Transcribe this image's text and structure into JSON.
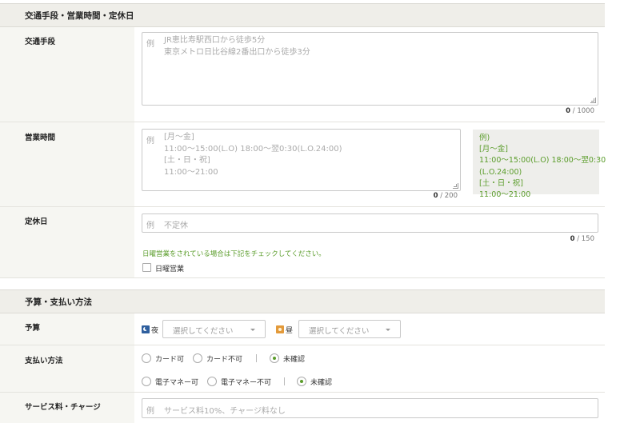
{
  "section_access": {
    "title": "交通手段・営業時間・定休日"
  },
  "access": {
    "label": "交通手段",
    "example_prefix": "例",
    "placeholder_lines": "JR恵比寿駅西口から徒歩5分\n東京メトロ日比谷線2番出口から徒歩3分",
    "count_current": "0",
    "count_max": " / 1000"
  },
  "hours": {
    "label": "営業時間",
    "example_prefix": "例",
    "placeholder_lines": "[月～金]\n11:00～15:00(L.O) 18:00～翌0:30(L.O.24:00)\n[土・日・祝]\n11:00～21:00",
    "count_current": "0",
    "count_max": " / 200",
    "example_box": "例)\n[月～金]\n11:00～15:00(L.O) 18:00～翌0:30\n(L.O.24:00)\n[土・日・祝]\n11:00～21:00"
  },
  "holiday": {
    "label": "定休日",
    "example_prefix": "例",
    "placeholder": "不定休",
    "count_current": "0",
    "count_max": " / 150",
    "note": "日曜営業をされている場合は下記をチェックしてください。",
    "sunday_label": "日曜営業"
  },
  "section_budget": {
    "title": "予算・支払い方法"
  },
  "budget": {
    "label": "予算",
    "night_label": "夜",
    "day_label": "昼",
    "night_select": "選択してください",
    "day_select": "選択してください"
  },
  "payment": {
    "label": "支払い方法",
    "card_options": [
      "カード可",
      "カード不可",
      "未確認"
    ],
    "emoney_options": [
      "電子マネー可",
      "電子マネー不可",
      "未確認"
    ],
    "card_selected": 2,
    "emoney_selected": 2
  },
  "service": {
    "label": "サービス料・チャージ",
    "example_prefix": "例",
    "placeholder": "サービス料10%、チャージ料なし"
  }
}
